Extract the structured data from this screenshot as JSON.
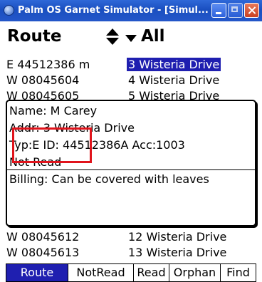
{
  "window": {
    "title": "Palm OS Garnet Simulator - [Simul...",
    "buttons": [
      "minimize",
      "maximize",
      "close"
    ]
  },
  "header": {
    "title": "Route",
    "filter": "All"
  },
  "rows_top": [
    {
      "meter": "E 44512386 m",
      "address": "3 Wisteria Drive",
      "selected": true
    },
    {
      "meter": "W 08045604",
      "address": "4 Wisteria Drive",
      "selected": false
    },
    {
      "meter": "W 08045605",
      "address": "5 Wisteria Drive",
      "selected": false
    }
  ],
  "popup": {
    "name": "Name: M Carey",
    "addr": "Addr: 3 Wisteria Drive",
    "typ": "Typ:E ID: 44512386A Acc:1003",
    "status": "Not Read",
    "billing": "Billing: Can be covered with leaves"
  },
  "rows_bottom": [
    {
      "meter": "W 08045612",
      "address": "12 Wisteria Drive"
    },
    {
      "meter": "W 08045613",
      "address": "13 Wisteria Drive"
    }
  ],
  "tabs": [
    {
      "label": "Route",
      "active": true
    },
    {
      "label": "NotRead",
      "active": false
    },
    {
      "label": "Read",
      "active": false
    },
    {
      "label": "Orphan",
      "active": false
    },
    {
      "label": "Find",
      "active": false
    }
  ],
  "colors": {
    "selection": "#1f1fb0",
    "highlight_box": "#e0141c",
    "titlebar": "#2457c9"
  }
}
